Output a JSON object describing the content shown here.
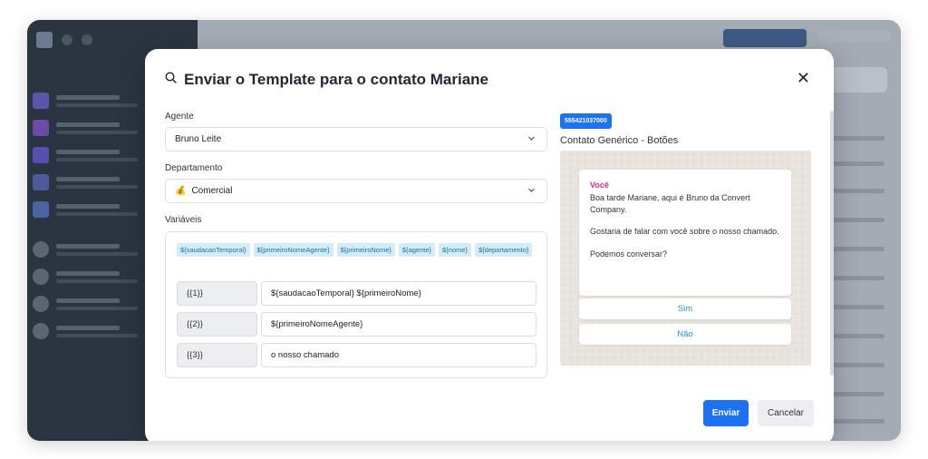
{
  "modal": {
    "title": "Enviar o Template para o contato Mariane",
    "close_glyph": "✕"
  },
  "form": {
    "agent_label": "Agente",
    "agent_value": "Bruno Leite",
    "department_label": "Departamento",
    "department_emoji": "💰",
    "department_value": "Comercial",
    "variables_label": "Variáveis",
    "chips": [
      "${saudacaoTemporal}",
      "${primeiroNomeAgente}",
      "${primeiroNome}",
      "${agente}",
      "${nome}",
      "${departamento}"
    ],
    "variables": [
      {
        "key": "{{1}}",
        "value": "${saudacaoTemporal} ${primeiroNome}"
      },
      {
        "key": "{{2}}",
        "value": "${primeiroNomeAgente}"
      },
      {
        "key": "{{3}}",
        "value": "o nosso chamado"
      }
    ]
  },
  "preview": {
    "phone": "555421037000",
    "template_name": "Contato Genérico - Botões",
    "sender": "Você",
    "message": [
      "Boa tarde Mariane, aqui é Bruno da Convert Company.",
      "Gostaria de falar com você sobre o nosso chamado.",
      "Podemos conversar?"
    ],
    "buttons": [
      "Sim",
      "Não"
    ]
  },
  "footer": {
    "send_label": "Enviar",
    "cancel_label": "Cancelar"
  },
  "icons": {
    "title_icon": "search-icon",
    "select_chevron": "chevron-down-icon"
  },
  "colors": {
    "primary": "#1d72f2",
    "chip_bg": "#d4ecf8",
    "sender": "#d6337f",
    "reply_button_text": "#2c8ed8"
  }
}
